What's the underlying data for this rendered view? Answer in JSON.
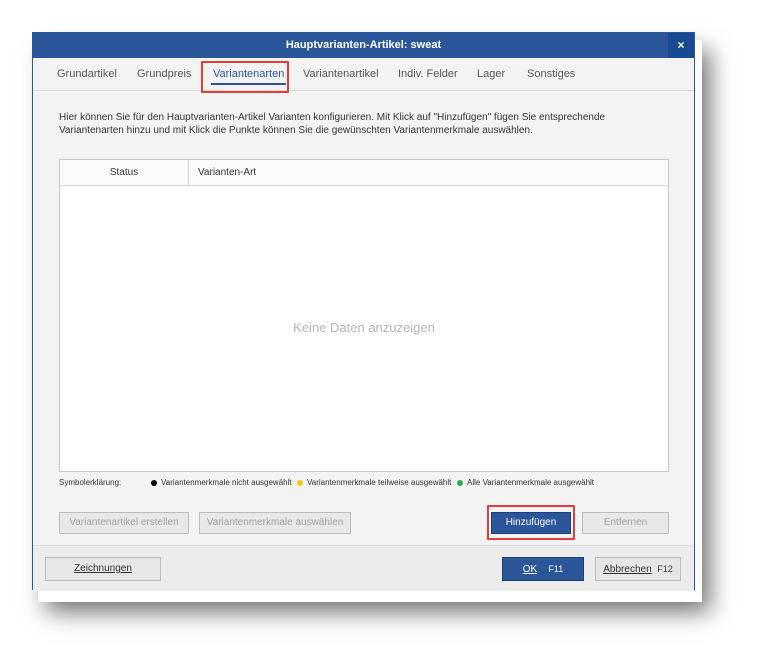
{
  "window": {
    "title": "Hauptvarianten-Artikel: sweat",
    "close_label": "×"
  },
  "tabs": [
    {
      "label": "Grundartikel"
    },
    {
      "label": "Grundpreis"
    },
    {
      "label": "Variantenarten"
    },
    {
      "label": "Variantenartikel"
    },
    {
      "label": "Indiv. Felder"
    },
    {
      "label": "Lager"
    },
    {
      "label": "Sonstiges"
    }
  ],
  "description": "Hier können Sie für den Hauptvarianten-Artikel Varianten konfigurieren. Mit Klick auf \"Hinzufügen\" fügen Sie entsprechende Variantenarten hinzu und mit Klick die Punkte können Sie die gewünschten Variantenmerkmale auswählen.",
  "grid": {
    "columns": [
      "Status",
      "Varianten-Art"
    ],
    "empty_text": "Keine Daten anzuzeigen"
  },
  "legend": {
    "label": "Symbolerklärung:",
    "items": [
      {
        "text": "Variantenmerkmale nicht ausgewählt",
        "color": "#000000"
      },
      {
        "text": "Variantenmerkmale teilweise ausgewählt",
        "color": "#f5c518"
      },
      {
        "text": "Alle Variantenmerkmale ausgewählt",
        "color": "#2eaa4e"
      }
    ]
  },
  "buttons": {
    "create": "Variantenartikel erstellen",
    "select": "Variantenmerkmale auswählen",
    "add": "Hinzufügen",
    "remove": "Entfernen"
  },
  "footer": {
    "drawings": "Zeichnungen",
    "ok": "OK",
    "ok_key": "F11",
    "cancel": "Abbrechen",
    "cancel_key": "F12"
  },
  "colors": {
    "accent": "#2b579a",
    "highlight": "#e23c3c"
  }
}
